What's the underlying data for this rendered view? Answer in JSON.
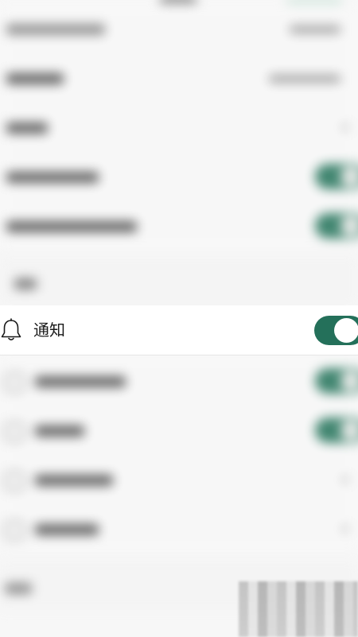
{
  "notification_row": {
    "label": "通知",
    "icon": "bell-icon",
    "toggle_on": true
  },
  "colors": {
    "toggle_on": "#24705a",
    "row_background": "#ffffff",
    "page_background": "#f7f7f7"
  }
}
